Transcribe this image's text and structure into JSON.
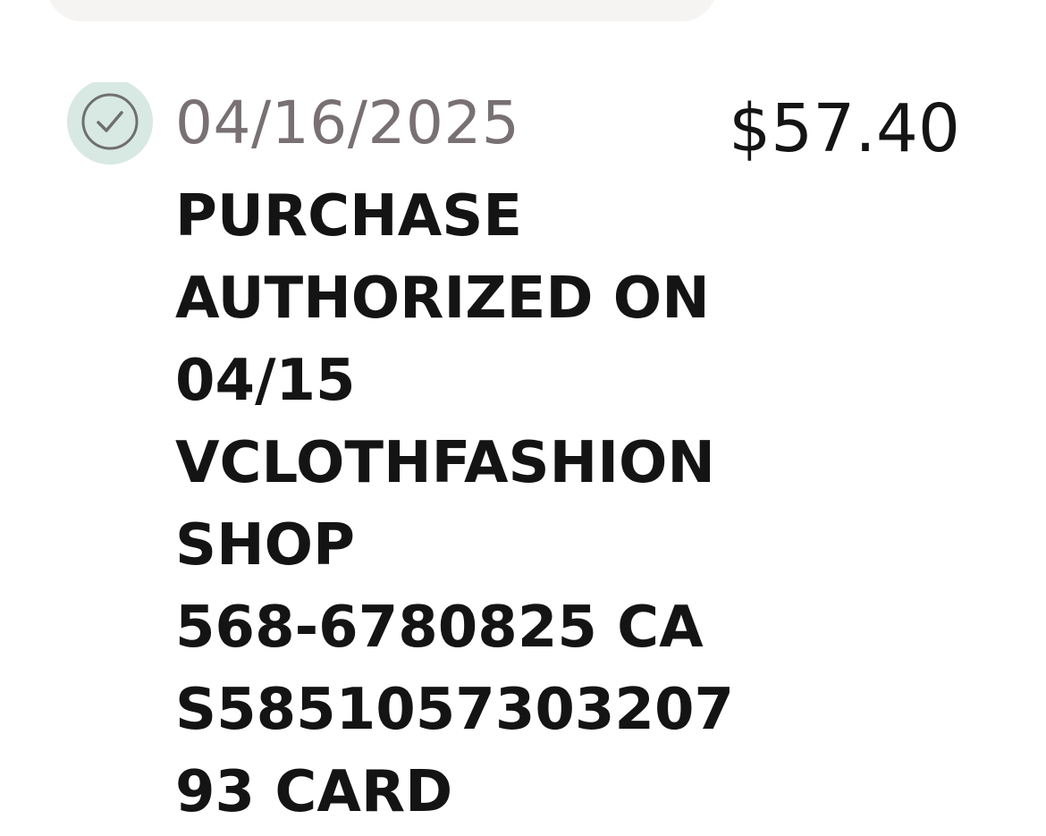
{
  "transaction": {
    "status_icon": "check-circle-icon",
    "date": "04/16/2025",
    "amount": "$57.40",
    "description_lines": [
      "PURCHASE",
      "AUTHORIZED ON",
      "04/15",
      "VCLOTHFASHION",
      "SHOP",
      "568-6780825 CA",
      "S5851057303207",
      "93 CARD"
    ]
  },
  "colors": {
    "icon_background": "#d8e8e3",
    "icon_stroke": "#6f6f6f",
    "date_text": "#787072",
    "primary_text": "#141414",
    "card_background": "#f6f4f2"
  }
}
